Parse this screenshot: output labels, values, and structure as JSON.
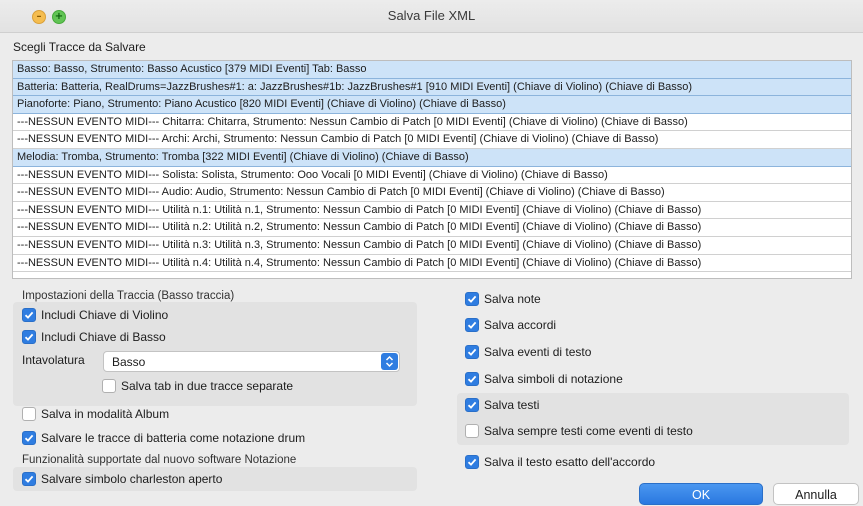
{
  "window": {
    "title": "Salva File XML"
  },
  "tracks_label": "Scegli Tracce da Salvare",
  "tracks": [
    {
      "text": "Basso: Basso, Strumento: Basso Acustico [379 MIDI Eventi] Tab: Basso",
      "selected": true
    },
    {
      "text": "Batteria: Batteria, RealDrums=JazzBrushes#1: a: JazzBrushes#1b: JazzBrushes#1 [910 MIDI Eventi] (Chiave di Violino) (Chiave di Basso)",
      "selected": true
    },
    {
      "text": "Pianoforte: Piano, Strumento: Piano Acustico [820 MIDI Eventi] (Chiave di Violino) (Chiave di Basso)",
      "selected": true
    },
    {
      "text": "---NESSUN EVENTO MIDI--- Chitarra: Chitarra, Strumento: Nessun Cambio di Patch [0 MIDI Eventi] (Chiave di Violino) (Chiave di Basso)",
      "selected": false
    },
    {
      "text": "---NESSUN EVENTO MIDI--- Archi: Archi, Strumento: Nessun Cambio di Patch [0 MIDI Eventi] (Chiave di Violino) (Chiave di Basso)",
      "selected": false
    },
    {
      "text": "Melodia: Tromba, Strumento: Tromba [322 MIDI Eventi] (Chiave di Violino) (Chiave di Basso)",
      "selected": true
    },
    {
      "text": "---NESSUN EVENTO MIDI--- Solista: Solista, Strumento: Ooo Vocali [0 MIDI Eventi] (Chiave di Violino) (Chiave di Basso)",
      "selected": false
    },
    {
      "text": "---NESSUN EVENTO MIDI--- Audio: Audio, Strumento: Nessun Cambio di Patch [0 MIDI Eventi] (Chiave di Violino) (Chiave di Basso)",
      "selected": false
    },
    {
      "text": "---NESSUN EVENTO MIDI--- Utilità n.1: Utilità n.1, Strumento: Nessun Cambio di Patch [0 MIDI Eventi] (Chiave di Violino) (Chiave di Basso)",
      "selected": false
    },
    {
      "text": "---NESSUN EVENTO MIDI--- Utilità n.2: Utilità n.2, Strumento: Nessun Cambio di Patch [0 MIDI Eventi] (Chiave di Violino) (Chiave di Basso)",
      "selected": false
    },
    {
      "text": "---NESSUN EVENTO MIDI--- Utilità n.3: Utilità n.3, Strumento: Nessun Cambio di Patch [0 MIDI Eventi] (Chiave di Violino) (Chiave di Basso)",
      "selected": false
    },
    {
      "text": "---NESSUN EVENTO MIDI--- Utilità n.4: Utilità n.4, Strumento: Nessun Cambio di Patch [0 MIDI Eventi] (Chiave di Violino) (Chiave di Basso)",
      "selected": false
    }
  ],
  "track_settings": {
    "title": "Impostazioni della Traccia  (Basso traccia)",
    "include_treble": {
      "label": "Includi Chiave di Violino",
      "checked": true
    },
    "include_bass": {
      "label": "Includi Chiave di Basso",
      "checked": true
    },
    "tablature_label": "Intavolatura",
    "tablature_value": "Basso",
    "tab_separate": {
      "label": "Salva tab in due tracce separate",
      "checked": false
    }
  },
  "album_mode": {
    "label": "Salva in modalità Album",
    "checked": false
  },
  "drum_notation": {
    "label": "Salvare le tracce di batteria come notazione drum",
    "checked": true
  },
  "notation_features_label": "Funzionalità supportate dal nuovo software Notazione",
  "open_hihat": {
    "label": "Salvare simbolo charleston aperto",
    "checked": true
  },
  "right_options": {
    "notes": {
      "label": "Salva note",
      "checked": true
    },
    "chords": {
      "label": "Salva accordi",
      "checked": true
    },
    "text_events": {
      "label": "Salva eventi di testo",
      "checked": true
    },
    "notation_symbols": {
      "label": "Salva simboli di notazione",
      "checked": true
    },
    "lyrics": {
      "label": "Salva testi",
      "checked": true
    },
    "lyrics_as_text": {
      "label": "Salva sempre testi come eventi di testo",
      "checked": false
    },
    "exact_chord_text": {
      "label": "Salva il testo esatto dell'accordo",
      "checked": true
    }
  },
  "buttons": {
    "ok": "OK",
    "cancel": "Annulla"
  },
  "colors": {
    "accent": "#2f7de1",
    "selection": "#cde3f8"
  }
}
